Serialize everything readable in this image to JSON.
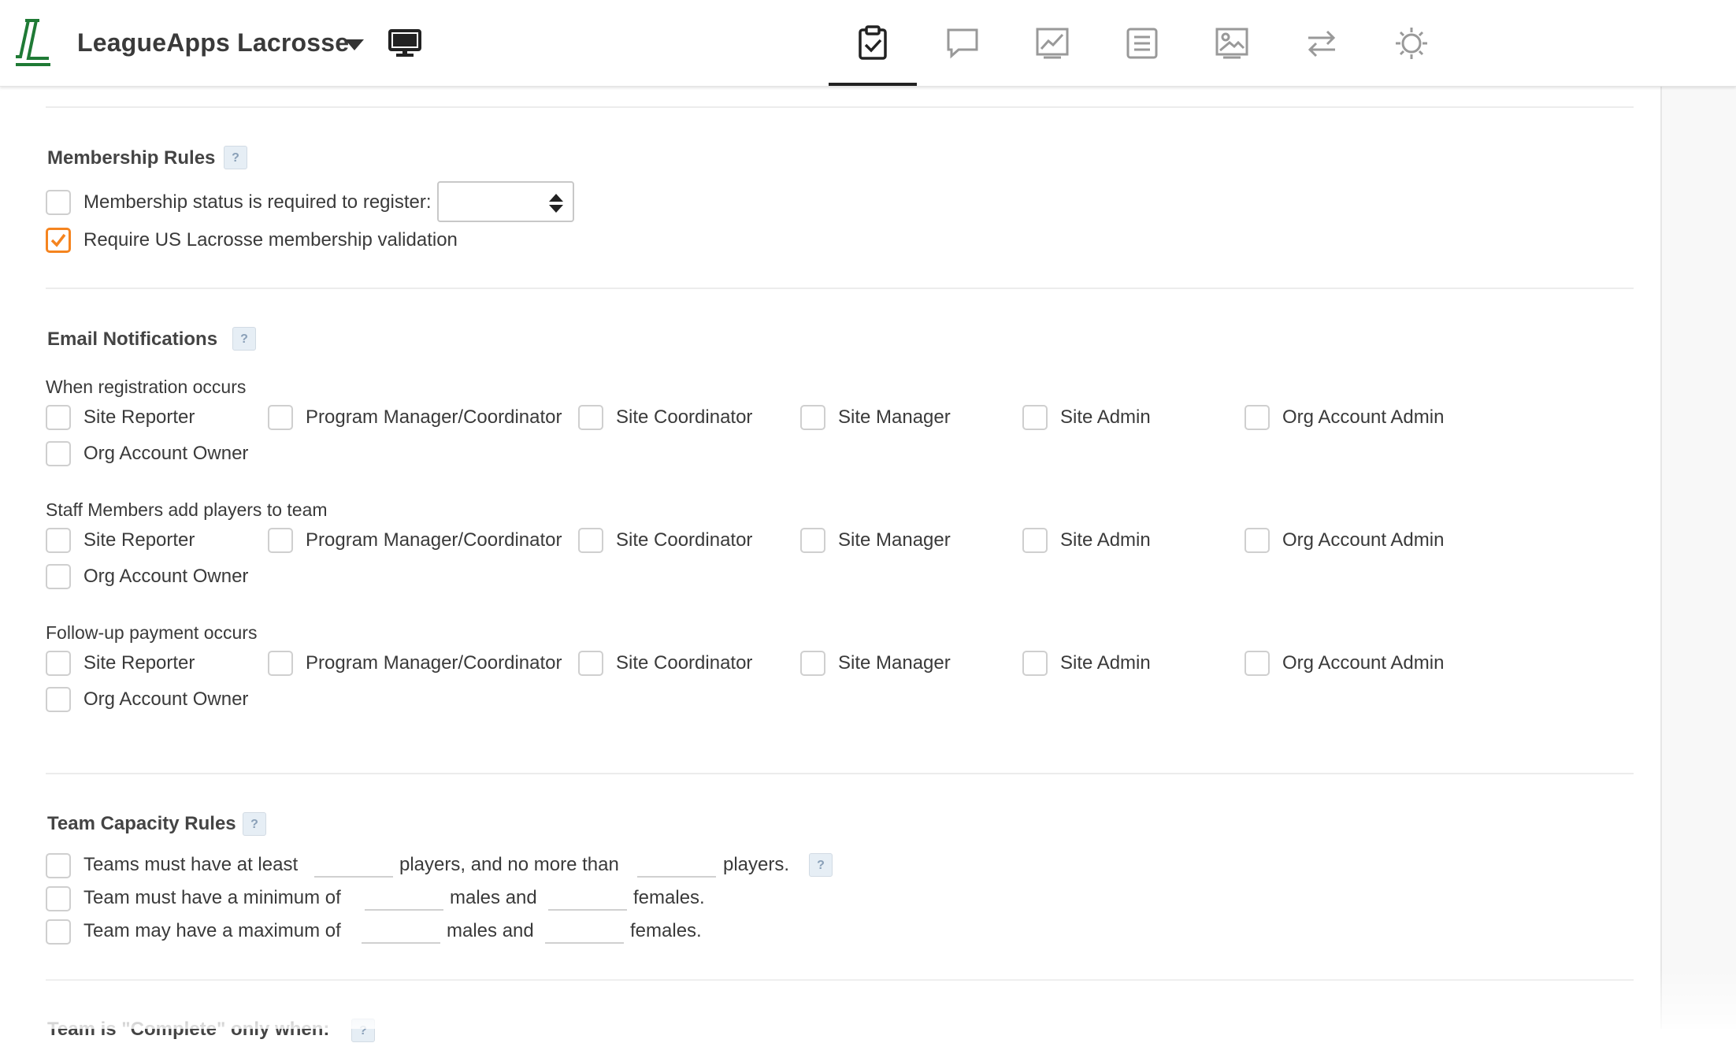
{
  "header": {
    "app_title": "LeagueApps Lacrosse",
    "logo_icon": "leagueapps-logo",
    "tabs": [
      {
        "icon": "clipboard-check-icon",
        "active": true
      },
      {
        "icon": "chat-bubble-icon",
        "active": false
      },
      {
        "icon": "chart-icon",
        "active": false
      },
      {
        "icon": "document-list-icon",
        "active": false
      },
      {
        "icon": "image-icon",
        "active": false
      },
      {
        "icon": "transfer-arrows-icon",
        "active": false
      },
      {
        "icon": "gear-icon",
        "active": false
      }
    ]
  },
  "membership_rules": {
    "title": "Membership Rules",
    "help": "?",
    "status_required_label": "Membership status is required to register:",
    "status_required_checked": false,
    "status_select_value": "",
    "us_lacrosse_label": "Require US Lacrosse membership validation",
    "us_lacrosse_checked": true
  },
  "email_notifications": {
    "title": "Email Notifications",
    "help": "?",
    "groups": [
      {
        "heading": "When registration occurs",
        "options": [
          "Site Reporter",
          "Program Manager/Coordinator",
          "Site Coordinator",
          "Site Manager",
          "Site Admin",
          "Org Account Admin",
          "Org Account Owner"
        ]
      },
      {
        "heading": "Staff Members add players to team",
        "options": [
          "Site Reporter",
          "Program Manager/Coordinator",
          "Site Coordinator",
          "Site Manager",
          "Site Admin",
          "Org Account Admin",
          "Org Account Owner"
        ]
      },
      {
        "heading": "Follow-up payment occurs",
        "options": [
          "Site Reporter",
          "Program Manager/Coordinator",
          "Site Coordinator",
          "Site Manager",
          "Site Admin",
          "Org Account Admin",
          "Org Account Owner"
        ]
      }
    ]
  },
  "team_capacity": {
    "title": "Team Capacity Rules",
    "help": "?",
    "row1": {
      "a": "Teams must have at least",
      "b": "players, and no more than",
      "c": "players.",
      "min_value": "",
      "max_value": ""
    },
    "row2": {
      "a": "Team must have a minimum of",
      "b": "males and",
      "c": "females.",
      "males_value": "",
      "females_value": ""
    },
    "row3": {
      "a": "Team may have a maximum of",
      "b": "males and",
      "c": "females.",
      "males_value": "",
      "females_value": ""
    }
  },
  "team_complete": {
    "title": "Team is \"Complete\" only when:",
    "help": "?"
  },
  "colors": {
    "accent": "#f5841f",
    "brand_green": "#1f7a35"
  }
}
